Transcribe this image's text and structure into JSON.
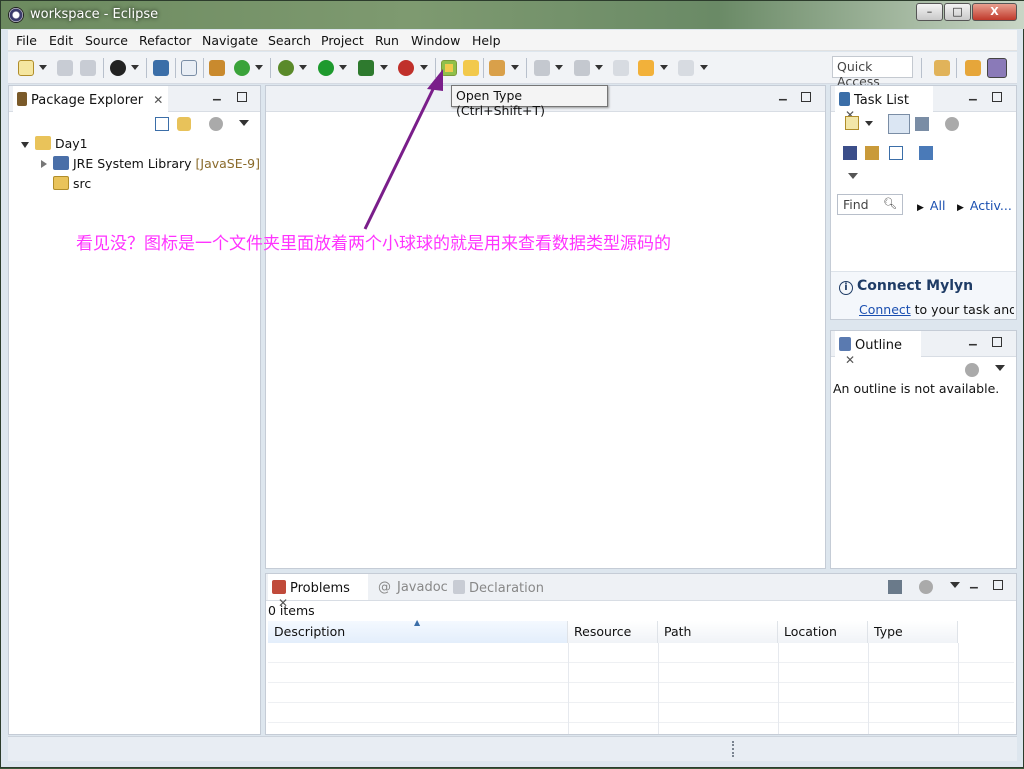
{
  "window": {
    "title": "workspace - Eclipse",
    "minimize": "–",
    "maximize": "□",
    "close": "X"
  },
  "menu": [
    "File",
    "Edit",
    "Source",
    "Refactor",
    "Navigate",
    "Search",
    "Project",
    "Run",
    "Window",
    "Help"
  ],
  "toolbar": {
    "quick_access": "Quick Access",
    "tooltip": "Open Type (Ctrl+Shift+T)"
  },
  "package_explorer": {
    "tab": "Package Explorer",
    "project": "Day1",
    "jre_label": "JRE System Library",
    "jre_version": "[JavaSE-9]",
    "src": "src"
  },
  "task_list": {
    "tab": "Task List",
    "find": "Find",
    "all": "All",
    "active": "Activ..."
  },
  "mylyn": {
    "title": "Connect Mylyn",
    "link": "Connect",
    "rest": " to your task and A"
  },
  "outline": {
    "tab": "Outline",
    "message": "An outline is not available."
  },
  "bottom": {
    "tabs": [
      "Problems",
      "Javadoc",
      "Declaration"
    ],
    "count": "0 items",
    "columns": [
      "Description",
      "Resource",
      "Path",
      "Location",
      "Type"
    ]
  },
  "annotation": "看见没？图标是一个文件夹里面放着两个小球球的就是用来查看数据类型源码的",
  "colors": {
    "annotation": "#ff33ff",
    "arrow": "#7a1e8a"
  }
}
